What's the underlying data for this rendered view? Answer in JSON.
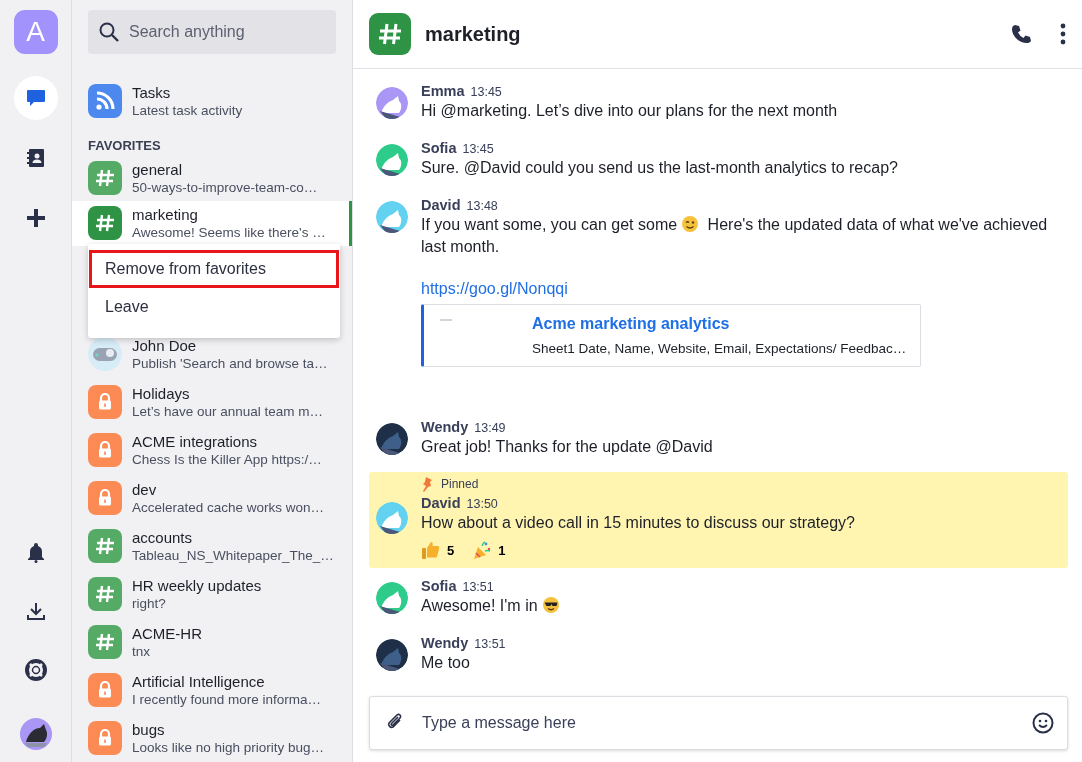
{
  "rail": {
    "logo": "A",
    "items": [
      {
        "kind": "chat",
        "selected": true
      },
      {
        "kind": "contacts",
        "selected": false
      },
      {
        "kind": "add",
        "selected": false
      }
    ],
    "bottom": [
      {
        "kind": "bell"
      },
      {
        "kind": "download"
      },
      {
        "kind": "help"
      },
      {
        "kind": "avatar"
      }
    ]
  },
  "sidebar": {
    "search": {
      "placeholder": "Search anything"
    },
    "feed": {
      "title": "Tasks",
      "subtitle": "Latest task activity"
    },
    "favorites_label": "FAVORITES",
    "favorites": [
      {
        "kind": "public",
        "name": "general",
        "preview": "50-ways-to-improve-team-co…",
        "selected": false
      },
      {
        "kind": "public",
        "name": "marketing",
        "preview": "Awesome! Seems like there's …",
        "selected": true
      }
    ],
    "context_menu": [
      {
        "label": "Remove from favorites",
        "highlighted": true
      },
      {
        "label": "Leave",
        "highlighted": false
      }
    ],
    "chats": [
      {
        "kind": "person",
        "name": "John Doe",
        "preview": "Publish 'Search and browse ta…",
        "selected": false
      },
      {
        "kind": "private",
        "name": "Holidays",
        "preview": "Let’s have our annual team m…",
        "selected": false
      },
      {
        "kind": "private",
        "name": "ACME integrations",
        "preview": "Chess Is the Killer App https:/…",
        "selected": false
      },
      {
        "kind": "private",
        "name": "dev",
        "preview": "Accelerated cache works won…",
        "selected": false
      },
      {
        "kind": "public",
        "name": "accounts",
        "preview": "Tableau_NS_Whitepaper_The_…",
        "selected": false
      },
      {
        "kind": "public",
        "name": "HR weekly updates",
        "preview": "right?",
        "selected": false
      },
      {
        "kind": "public",
        "name": "ACME-HR",
        "preview": "tnx",
        "selected": false
      },
      {
        "kind": "private",
        "name": "Artificial Intelligence",
        "preview": "I recently found more informa…",
        "selected": false
      },
      {
        "kind": "private",
        "name": "bugs",
        "preview": "Looks like no high priority bug…",
        "selected": false
      }
    ]
  },
  "header": {
    "title": "marketing"
  },
  "messages": [
    {
      "author": "Emma",
      "time": "13:45",
      "color": "#a996f5",
      "parts": [
        {
          "kind": "text",
          "text": "Hi @marketing. Let’s dive into our plans for the next month"
        }
      ]
    },
    {
      "author": "Sofia",
      "time": "13:45",
      "color": "#2ecc8a",
      "parts": [
        {
          "kind": "text",
          "text": "Sure. @David could you send us the last-month analytics to recap?"
        }
      ]
    },
    {
      "author": "David",
      "time": "13:48",
      "color": "#62d2f0",
      "parts": [
        {
          "kind": "text",
          "text": "If you want some, you can get some"
        },
        {
          "kind": "wink"
        },
        {
          "kind": "text",
          "text": "Here's the updated data of what we've achieved"
        },
        {
          "kind": "text",
          "text": "last month."
        }
      ],
      "link": "https://goo.gl/Nonqqi",
      "preview": {
        "title": "Acme marketing analytics",
        "text": "Sheet1 Date, Name, Website, Email, Expectations/ Feedbac…"
      }
    },
    {
      "author": "Wendy",
      "time": "13:49",
      "color": "#1e3048",
      "parts": [
        {
          "kind": "text",
          "text": "Great job! Thanks for the update @David"
        }
      ]
    },
    {
      "author": "David",
      "time": "13:50",
      "color": "#62d2f0",
      "pinned": "Pinned",
      "parts": [
        {
          "kind": "text",
          "text": "How about a video call in 15 minutes to discuss our strategy?"
        }
      ],
      "reactions": [
        {
          "kind": "thumbs-up",
          "count": "5"
        },
        {
          "kind": "party",
          "count": "1"
        }
      ]
    },
    {
      "author": "Sofia",
      "time": "13:51",
      "color": "#2ecc8a",
      "parts": [
        {
          "kind": "text",
          "text": "Awesome! I'm in"
        },
        {
          "kind": "cool"
        }
      ]
    },
    {
      "author": "Wendy",
      "time": "13:51",
      "color": "#1e3048",
      "parts": [
        {
          "kind": "text",
          "text": "Me too"
        }
      ]
    }
  ],
  "composer": {
    "placeholder": "Type a message here"
  }
}
